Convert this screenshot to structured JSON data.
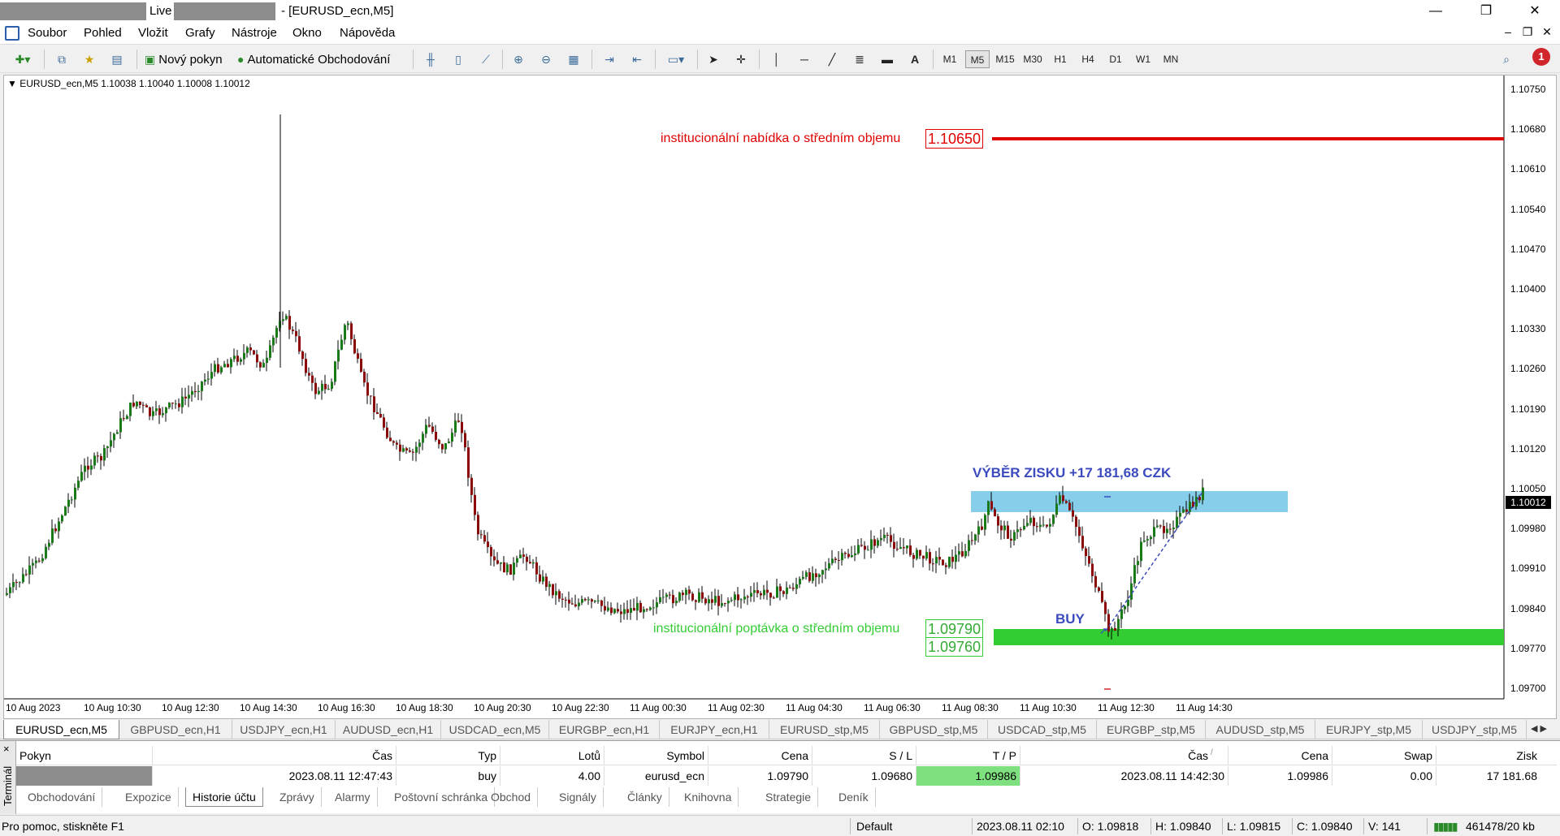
{
  "window": {
    "title_live": "Live",
    "title_suffix": "- [EURUSD_ecn,M5]",
    "min_icon": "—",
    "max_icon": "❐",
    "close_icon": "✕"
  },
  "menu": [
    "Soubor",
    "Pohled",
    "Vložit",
    "Grafy",
    "Nástroje",
    "Okno",
    "Nápověda"
  ],
  "mdi": {
    "min": "–",
    "restore": "❐",
    "close": "✕"
  },
  "toolbar": {
    "new_order_label": "Nový pokyn",
    "auto_trading_label": "Automatické Obchodování",
    "text_tool": "A",
    "timeframes": [
      "M1",
      "M5",
      "M15",
      "M30",
      "H1",
      "H4",
      "D1",
      "W1",
      "MN"
    ],
    "active_timeframe": "M5",
    "notification_count": "1"
  },
  "chart": {
    "symbol_info": "EURUSD_ecn,M5  1.10038 1.10040 1.10008 1.10012",
    "current_price": "1.10012",
    "supply_label": "institucionální nabídka o středním objemu",
    "supply_price": "1.10650",
    "demand_label": "institucionální poptávka o středním objemu",
    "demand_price_top": "1.09790",
    "demand_price_bottom": "1.09760",
    "profit_label": "VÝBĚR ZISKU +17 181,68 CZK",
    "buy_label": "BUY",
    "colors": {
      "bull": "#1a7a1a",
      "bear": "#8b0a0a",
      "supply": "#e00000",
      "demand": "#33cc33",
      "profit_zone": "#87ceeb",
      "annotation": "#3b4bbf"
    },
    "price_axis": [
      "1.10750",
      "1.10680",
      "1.10610",
      "1.10540",
      "1.10470",
      "1.10400",
      "1.10330",
      "1.10260",
      "1.10190",
      "1.10120",
      "1.10050",
      "1.09980",
      "1.09910",
      "1.09840",
      "1.09770",
      "1.09700"
    ],
    "time_axis": [
      "10 Aug 2023",
      "10 Aug 10:30",
      "10 Aug 12:30",
      "10 Aug 14:30",
      "10 Aug 16:30",
      "10 Aug 18:30",
      "10 Aug 20:30",
      "10 Aug 22:30",
      "11 Aug 00:30",
      "11 Aug 02:30",
      "11 Aug 04:30",
      "11 Aug 06:30",
      "11 Aug 08:30",
      "11 Aug 10:30",
      "11 Aug 12:30",
      "11 Aug 14:30"
    ]
  },
  "chart_tabs": [
    "EURUSD_ecn,M5",
    "GBPUSD_ecn,H1",
    "USDJPY_ecn,H1",
    "AUDUSD_ecn,H1",
    "USDCAD_ecn,M5",
    "EURGBP_ecn,H1",
    "EURJPY_ecn,H1",
    "EURUSD_stp,M5",
    "GBPUSD_stp,M5",
    "USDCAD_stp,M5",
    "EURGBP_stp,M5",
    "AUDUSD_stp,M5",
    "EURJPY_stp,M5",
    "USDJPY_stp,M5"
  ],
  "terminal": {
    "side_label": "Terminál",
    "close": "×",
    "headers": {
      "order": "Pokyn",
      "time": "Čas",
      "type": "Typ",
      "lots": "Lotů",
      "symbol": "Symbol",
      "price": "Cena",
      "sl": "S / L",
      "tp": "T / P",
      "close_time": "Čas",
      "sort_mark": "/",
      "close_price": "Cena",
      "swap": "Swap",
      "profit": "Zisk"
    },
    "row": {
      "time": "2023.08.11 12:47:43",
      "type": "buy",
      "lots": "4.00",
      "symbol": "eurusd_ecn",
      "price": "1.09790",
      "sl": "1.09680",
      "tp": "1.09986",
      "close_time": "2023.08.11 14:42:30",
      "close_price": "1.09986",
      "swap": "0.00",
      "profit": "17 181.68"
    },
    "tabs": [
      "Obchodování",
      "Expozice",
      "Historie účtu",
      "Zprávy",
      "Alarmy",
      "Poštovní schránka",
      "Obchod",
      "Signály",
      "Články",
      "Knihovna",
      "Strategie",
      "Deník"
    ],
    "active_tab": "Historie účtu"
  },
  "status": {
    "help": "Pro pomoc, stiskněte F1",
    "profile": "Default",
    "datetime": "2023.08.11 02:10",
    "open": "O: 1.09818",
    "high": "H: 1.09840",
    "low": "L: 1.09815",
    "close": "C: 1.09840",
    "volume": "V: 141",
    "traffic": "461478/20 kb"
  }
}
